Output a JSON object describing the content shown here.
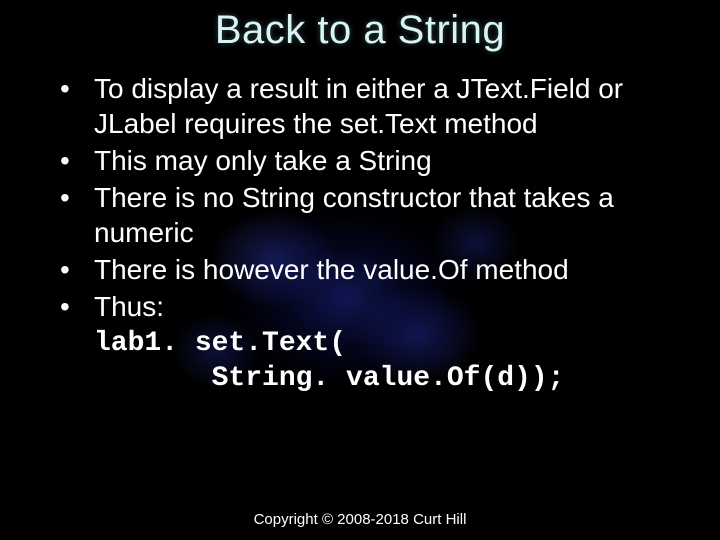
{
  "title": "Back to a String",
  "bullets": [
    "To display a result in either a JText.Field or JLabel requires the set.Text method",
    "This may only take a String",
    "There is no String constructor that takes a numeric",
    "There is however the value.Of method",
    "Thus:"
  ],
  "code": {
    "line1": "lab1. set.Text(",
    "line2": "       String. value.Of(d));"
  },
  "footer": "Copyright © 2008-2018 Curt Hill"
}
